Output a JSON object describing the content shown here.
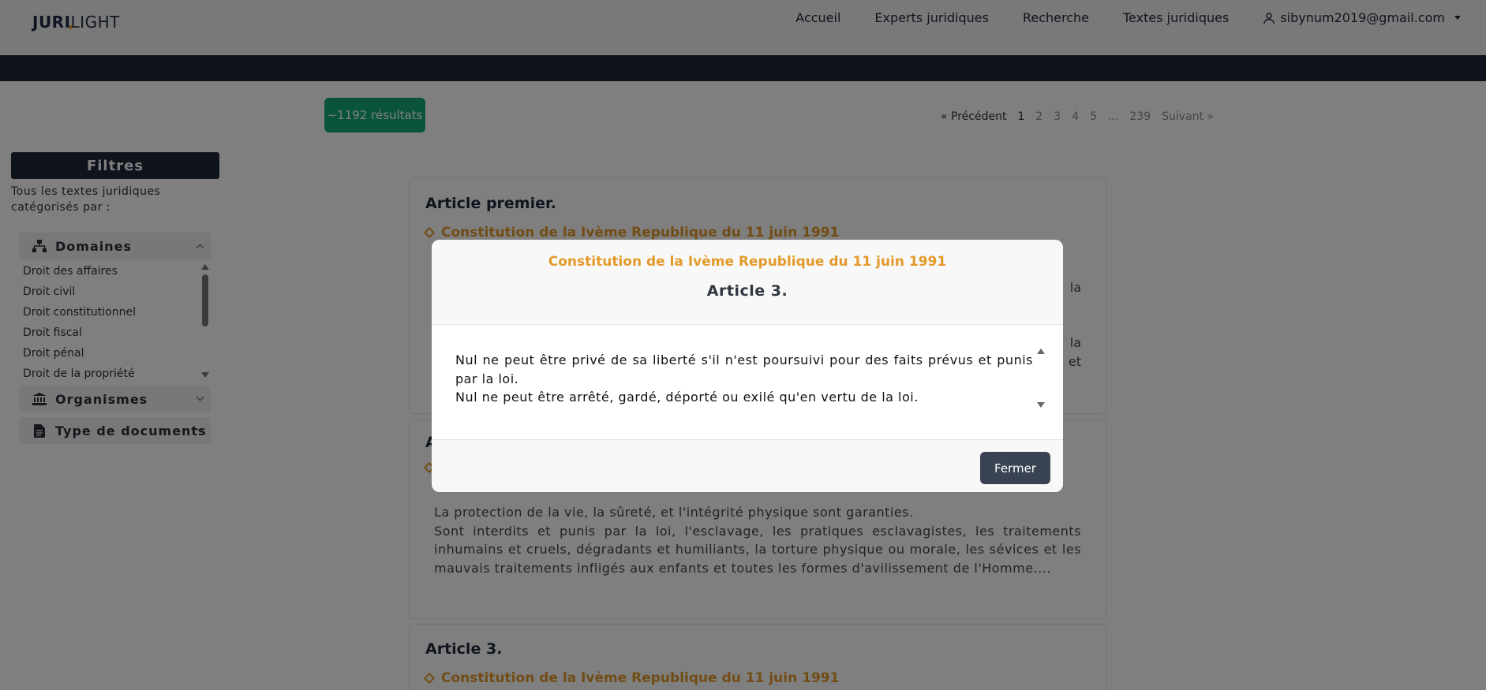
{
  "navbar": {
    "logo_bold": "JURI",
    "logo_light": "LIGHT",
    "links": [
      "Accueil",
      "Experts juridiques",
      "Recherche",
      "Textes juridiques"
    ],
    "user_email": "sibynum2019@gmail.com"
  },
  "results": {
    "count_label": "~1192 résultats"
  },
  "pagination": {
    "prev": "« Précédent",
    "pages": [
      "1",
      "2",
      "3",
      "4",
      "5",
      "...",
      "239"
    ],
    "next": "Suivant »",
    "current": "1"
  },
  "sidebar": {
    "title": "Filtres",
    "description": "Tous les textes juridiques catégorisés par :",
    "domaines_label": "Domaines",
    "domaines_items": [
      "Droit des affaires",
      "Droit civil",
      "Droit constitutionnel",
      "Droit fiscal",
      "Droit pénal",
      "Droit de la propriété"
    ],
    "organismes_label": "Organismes",
    "type_label": "Type de documents"
  },
  "articles": [
    {
      "title": "Article premier.",
      "source": "Constitution de la Ivème Republique du 11 juin 1991",
      "text_fragments": [
        "la",
        "la",
        "et"
      ]
    },
    {
      "title": "A",
      "source": "",
      "text": "La protection de la vie, la sûreté, et l'intégrité physique sont garanties.\nSont interdits et punis par la loi, l'esclavage, les pratiques esclavagistes, les traitements inhumains et cruels, dégradants et humiliants, la torture physique ou morale, les sévices et les mauvais traitements infligés aux enfants et toutes les formes d'avilissement de l'Homme...."
    },
    {
      "title": "Article 3.",
      "source": "Constitution de la Ivème Republique du 11 juin 1991"
    }
  ],
  "modal": {
    "source": "Constitution de la Ivème Republique du 11 juin 1991",
    "title": "Article 3.",
    "text": "Nul ne peut être privé de sa liberté s'il n'est poursuivi pour des faits prévus et punis par la loi.\nNul ne peut être arrêté, gardé, déporté ou exilé qu'en vertu de la loi.",
    "close_label": "Fermer"
  },
  "colors": {
    "accent": "#e39a2b",
    "navy": "#1e2638",
    "badge": "#14a87a",
    "button": "#3a4352"
  }
}
